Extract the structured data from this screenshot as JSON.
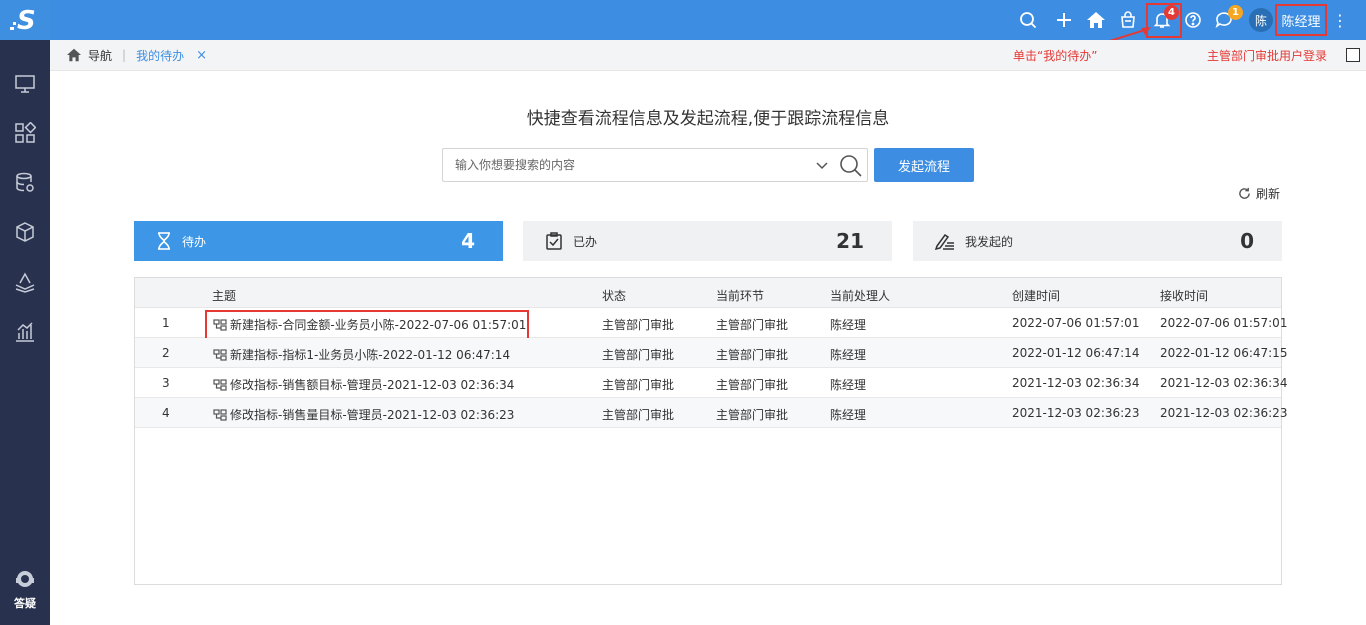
{
  "app": {
    "logo": "S"
  },
  "sidebar": {
    "items": [
      {
        "icon": "monitor-icon"
      },
      {
        "icon": "grid-icon"
      },
      {
        "icon": "database-icon"
      },
      {
        "icon": "box-icon"
      },
      {
        "icon": "layers-icon"
      },
      {
        "icon": "chart-icon"
      }
    ],
    "faq_label": "答疑"
  },
  "topbar": {
    "notification_count": "4",
    "message_count": "1",
    "avatar_text": "陈",
    "username": "陈经理"
  },
  "breadcrumb": {
    "home_label": "导航",
    "sep": "|",
    "tab_label": "我的待办",
    "close": "×"
  },
  "annotations": {
    "click_hint": "单击“我的待办”",
    "login_hint": "主管部门审批用户登录"
  },
  "hero": {
    "title": "快捷查看流程信息及发起流程,便于跟踪流程信息"
  },
  "search": {
    "placeholder": "输入你想要搜索的内容",
    "start_button": "发起流程"
  },
  "refresh_label": "刷新",
  "cards": [
    {
      "label": "待办",
      "count": "4"
    },
    {
      "label": "已办",
      "count": "21"
    },
    {
      "label": "我发起的",
      "count": "0"
    }
  ],
  "table": {
    "headers": [
      "主题",
      "状态",
      "当前环节",
      "当前处理人",
      "创建时间",
      "接收时间"
    ],
    "rows": [
      {
        "no": "1",
        "subject": "新建指标-合同金额-业务员小陈-2022-07-06 01:57:01",
        "status": "主管部门审批",
        "step": "主管部门审批",
        "handler": "陈经理",
        "created": "2022-07-06 01:57:01",
        "received": "2022-07-06 01:57:01"
      },
      {
        "no": "2",
        "subject": "新建指标-指标1-业务员小陈-2022-01-12 06:47:14",
        "status": "主管部门审批",
        "step": "主管部门审批",
        "handler": "陈经理",
        "created": "2022-01-12 06:47:14",
        "received": "2022-01-12 06:47:15"
      },
      {
        "no": "3",
        "subject": "修改指标-销售额目标-管理员-2021-12-03 02:36:34",
        "status": "主管部门审批",
        "step": "主管部门审批",
        "handler": "陈经理",
        "created": "2021-12-03 02:36:34",
        "received": "2021-12-03 02:36:34"
      },
      {
        "no": "4",
        "subject": "修改指标-销售量目标-管理员-2021-12-03 02:36:23",
        "status": "主管部门审批",
        "step": "主管部门审批",
        "handler": "陈经理",
        "created": "2021-12-03 02:36:23",
        "received": "2021-12-03 02:36:23"
      }
    ]
  },
  "colors": {
    "accent": "#3d8ee2",
    "sidebar": "#28324e",
    "highlight": "#e53935",
    "badge_red": "#e53935",
    "badge_orange": "#f5a623"
  }
}
